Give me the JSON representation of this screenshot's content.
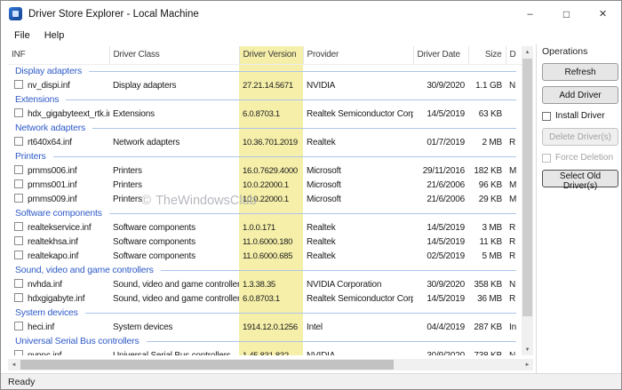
{
  "window": {
    "title": "Driver Store Explorer - Local Machine"
  },
  "titlebar": {
    "minimize_icon": "–",
    "maximize_icon": "□",
    "close_icon": "✕"
  },
  "menu": {
    "items": [
      "File",
      "Help"
    ]
  },
  "icons": {
    "up": "▲",
    "down": "▼",
    "left": "◄",
    "right": "►"
  },
  "table": {
    "columns": [
      {
        "label": "INF"
      },
      {
        "label": "Driver Class"
      },
      {
        "label": "Driver Version",
        "highlight": true
      },
      {
        "label": "Provider"
      },
      {
        "label": "Driver Date"
      },
      {
        "label": "Size"
      },
      {
        "label": "D"
      }
    ],
    "groups": [
      {
        "label": "Display adapters",
        "rows": [
          {
            "inf": "nv_dispi.inf",
            "class": "Display adapters",
            "version": "27.21.14.5671",
            "provider": "NVIDIA",
            "date": "30/9/2020",
            "size": "1.1 GB",
            "extra": "N"
          }
        ]
      },
      {
        "label": "Extensions",
        "rows": [
          {
            "inf": "hdx_gigabyteext_rtk.inf",
            "class": "Extensions",
            "version": "6.0.8703.1",
            "provider": "Realtek Semiconductor Corp.",
            "date": "14/5/2019",
            "size": "63 KB",
            "extra": ""
          }
        ]
      },
      {
        "label": "Network adapters",
        "rows": [
          {
            "inf": "rt640x64.inf",
            "class": "Network adapters",
            "version": "10.36.701.2019",
            "provider": "Realtek",
            "date": "01/7/2019",
            "size": "2 MB",
            "extra": "R"
          }
        ]
      },
      {
        "label": "Printers",
        "rows": [
          {
            "inf": "prnms006.inf",
            "class": "Printers",
            "version": "16.0.7629.4000",
            "provider": "Microsoft",
            "date": "29/11/2016",
            "size": "182 KB",
            "extra": "M"
          },
          {
            "inf": "prnms001.inf",
            "class": "Printers",
            "version": "10.0.22000.1",
            "provider": "Microsoft",
            "date": "21/6/2006",
            "size": "96 KB",
            "extra": "M"
          },
          {
            "inf": "prnms009.inf",
            "class": "Printers",
            "version": "10.0.22000.1",
            "provider": "Microsoft",
            "date": "21/6/2006",
            "size": "29 KB",
            "extra": "M"
          }
        ]
      },
      {
        "label": "Software components",
        "rows": [
          {
            "inf": "realtekservice.inf",
            "class": "Software components",
            "version": "1.0.0.171",
            "provider": "Realtek",
            "date": "14/5/2019",
            "size": "3 MB",
            "extra": "R"
          },
          {
            "inf": "realtekhsa.inf",
            "class": "Software components",
            "version": "11.0.6000.180",
            "provider": "Realtek",
            "date": "14/5/2019",
            "size": "11 KB",
            "extra": "R"
          },
          {
            "inf": "realtekapo.inf",
            "class": "Software components",
            "version": "11.0.6000.685",
            "provider": "Realtek",
            "date": "02/5/2019",
            "size": "5 MB",
            "extra": "R"
          }
        ]
      },
      {
        "label": "Sound, video and game controllers",
        "rows": [
          {
            "inf": "nvhda.inf",
            "class": "Sound, video and game controllers",
            "version": "1.3.38.35",
            "provider": "NVIDIA Corporation",
            "date": "30/9/2020",
            "size": "358 KB",
            "extra": "N"
          },
          {
            "inf": "hdxgigabyte.inf",
            "class": "Sound, video and game controllers",
            "version": "6.0.8703.1",
            "provider": "Realtek Semiconductor Corp.",
            "date": "14/5/2019",
            "size": "36 MB",
            "extra": "R"
          }
        ]
      },
      {
        "label": "System devices",
        "rows": [
          {
            "inf": "heci.inf",
            "class": "System devices",
            "version": "1914.12.0.1256",
            "provider": "Intel",
            "date": "04/4/2019",
            "size": "287 KB",
            "extra": "In"
          }
        ]
      },
      {
        "label": "Universal Serial Bus controllers",
        "rows": [
          {
            "inf": "nvpnc.inf",
            "class": "Universal Serial Bus controllers",
            "version": "1.45.831.832",
            "provider": "NVIDIA",
            "date": "30/9/2020",
            "size": "738 KB",
            "extra": "N"
          }
        ]
      }
    ]
  },
  "operations": {
    "title": "Operations",
    "refresh": "Refresh",
    "add_driver": "Add Driver",
    "install_driver": "Install Driver",
    "delete_driver": "Delete Driver(s)",
    "force_deletion": "Force Deletion",
    "select_old": "Select Old Driver(s)"
  },
  "statusbar": {
    "text": "Ready"
  },
  "watermark": {
    "symbol": "©",
    "text": "TheWindowsClub"
  },
  "colors": {
    "highlight_column": "#f5efa9",
    "group_text": "#2f5bc8",
    "app_accent": "#1b4fa0"
  }
}
